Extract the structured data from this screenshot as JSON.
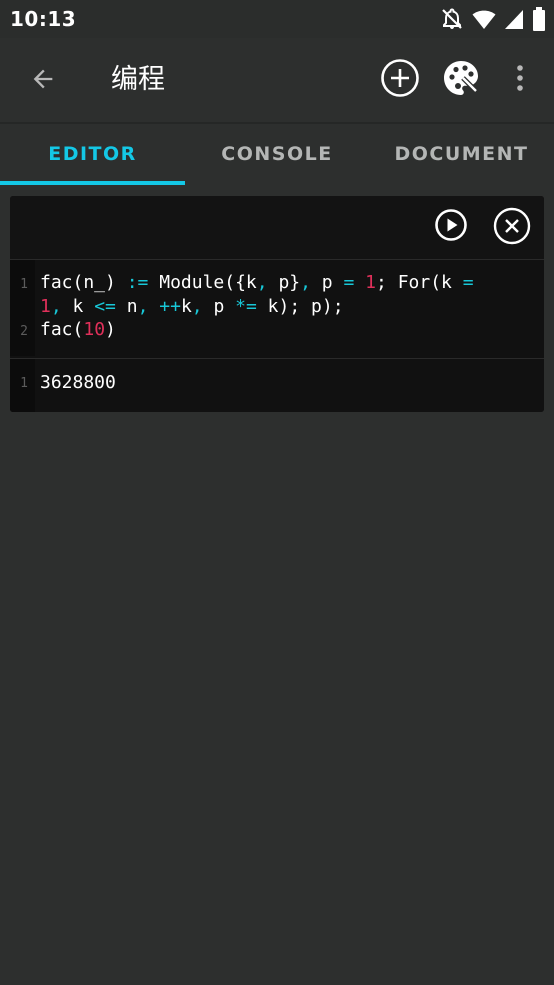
{
  "status_bar": {
    "time": "10:13",
    "icons": [
      "notifications-off-icon",
      "wifi-icon",
      "signal-icon",
      "battery-icon"
    ]
  },
  "app_bar": {
    "title": "编程",
    "back_icon": "arrow-back-icon",
    "add_icon": "add-circle-icon",
    "palette_icon": "palette-icon",
    "more_icon": "more-vert-icon"
  },
  "tabs": {
    "items": [
      {
        "label": "EDITOR",
        "active": true
      },
      {
        "label": "CONSOLE",
        "active": false
      },
      {
        "label": "DOCUMENT",
        "active": false
      }
    ]
  },
  "editor": {
    "run_icon": "play-circle-icon",
    "close_icon": "close-circle-icon",
    "code_lines": [
      {
        "number": "1",
        "wrapped": [
          [
            {
              "t": "fac(n_) ",
              "c": ""
            },
            {
              "t": ":=",
              "c": "op"
            },
            {
              "t": " Module({k",
              "c": ""
            },
            {
              "t": ",",
              "c": "op"
            },
            {
              "t": " p}",
              "c": ""
            },
            {
              "t": ",",
              "c": "op"
            },
            {
              "t": " p ",
              "c": ""
            },
            {
              "t": "=",
              "c": "op"
            },
            {
              "t": " ",
              "c": ""
            },
            {
              "t": "1",
              "c": "num"
            },
            {
              "t": "; For(k ",
              "c": ""
            },
            {
              "t": "=",
              "c": "op"
            }
          ],
          [
            {
              "t": "1",
              "c": "num"
            },
            {
              "t": ",",
              "c": "op"
            },
            {
              "t": " k ",
              "c": ""
            },
            {
              "t": "<=",
              "c": "op"
            },
            {
              "t": " n",
              "c": ""
            },
            {
              "t": ",",
              "c": "op"
            },
            {
              "t": " ",
              "c": ""
            },
            {
              "t": "++",
              "c": "op"
            },
            {
              "t": "k",
              "c": ""
            },
            {
              "t": ",",
              "c": "op"
            },
            {
              "t": " p ",
              "c": ""
            },
            {
              "t": "*=",
              "c": "op"
            },
            {
              "t": " k); p);",
              "c": ""
            }
          ]
        ]
      },
      {
        "number": "2",
        "wrapped": [
          [
            {
              "t": "fac(",
              "c": ""
            },
            {
              "t": "10",
              "c": "num"
            },
            {
              "t": ")",
              "c": ""
            }
          ]
        ]
      }
    ],
    "output_lines": [
      {
        "number": "1",
        "text": "3628800"
      }
    ]
  },
  "colors": {
    "accent": "#14c8e6",
    "background": "#2d2f2e",
    "editor_background": "#111111",
    "operator": "#18c8d8",
    "number": "#e0305a"
  }
}
